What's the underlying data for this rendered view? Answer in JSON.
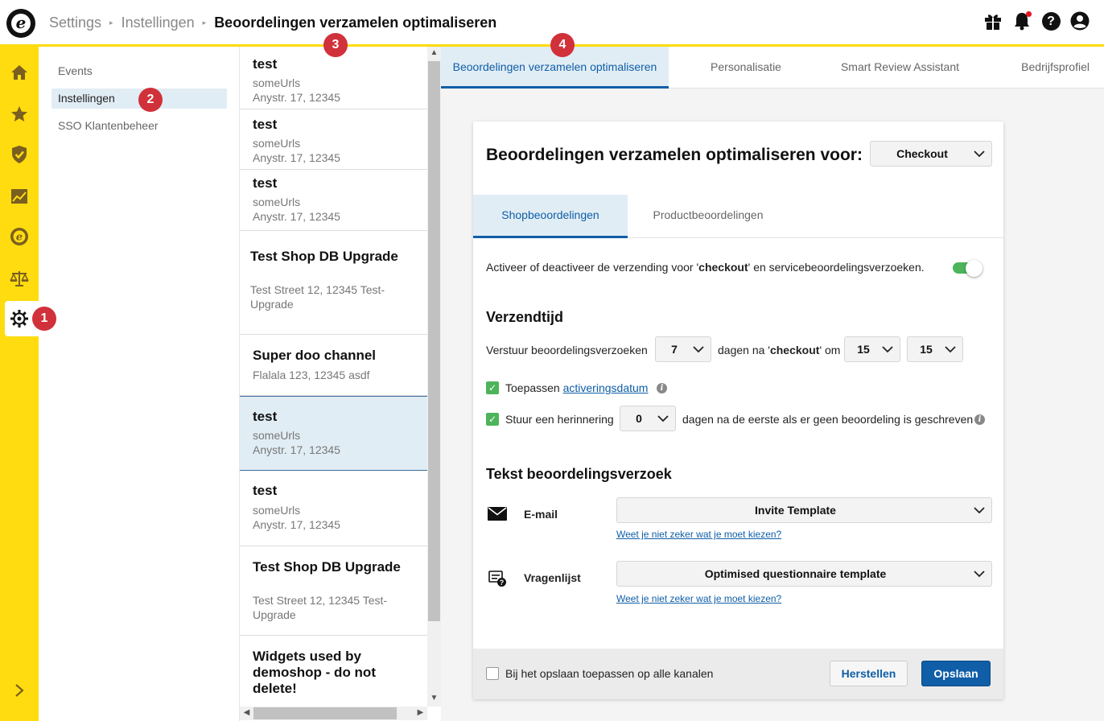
{
  "header": {
    "breadcrumbs": [
      "Settings",
      "Instellingen"
    ],
    "current_page": "Beoordelingen verzamelen optimaliseren",
    "help_glyph": "?",
    "icons": [
      "gift-icon",
      "bell-icon",
      "help-icon",
      "account-icon"
    ],
    "notification_color": "#e3141c"
  },
  "rail": {
    "items": [
      "home-icon",
      "star-icon",
      "shield-check-icon",
      "chart-icon",
      "etrusted-icon",
      "scales-icon",
      "gear-icon"
    ],
    "active": "gear-icon",
    "expand_icon": "chevron-right-icon",
    "accent_color": "#ffdc0f"
  },
  "badges": [
    "1",
    "2",
    "3",
    "4"
  ],
  "subnav": {
    "items": [
      {
        "label": "Events"
      },
      {
        "label": "Instellingen"
      },
      {
        "label": "SSO Klantenbeheer"
      }
    ],
    "active": "Instellingen"
  },
  "channels": [
    {
      "name": "test",
      "lines": [
        "someUrls",
        "Anystr. 17, 12345"
      ]
    },
    {
      "name": "test",
      "lines": [
        "someUrls",
        "Anystr. 17, 12345"
      ]
    },
    {
      "name": "test",
      "lines": [
        "someUrls",
        "Anystr. 17, 12345"
      ]
    },
    {
      "name": "Test Shop DB Upgrade",
      "lines": [
        "Test Street 12, 12345 Test-",
        "Upgrade"
      ]
    },
    {
      "name": "Super doo channel",
      "lines": [
        "Flalala 123, 12345 asdf"
      ]
    },
    {
      "name": "test",
      "lines": [
        "someUrls",
        "Anystr. 17, 12345"
      ]
    },
    {
      "name": "test",
      "lines": [
        "someUrls",
        "Anystr. 17, 12345"
      ]
    },
    {
      "name": "Test Shop DB Upgrade",
      "lines": [
        "Test Street 12, 12345 Test-",
        "Upgrade"
      ]
    },
    {
      "name": "Widgets used by demoshop - do not delete!",
      "name_lines": [
        "Widgets used by",
        "demoshop - do not",
        "delete!"
      ],
      "lines": []
    }
  ],
  "tabs": [
    {
      "label": "Beoordelingen verzamelen optimaliseren",
      "active": true
    },
    {
      "label": "Personalisatie"
    },
    {
      "label": "Smart Review Assistant"
    },
    {
      "label": "Bedrijfsprofiel"
    }
  ],
  "card": {
    "title": "Beoordelingen verzamelen optimaliseren voor:",
    "trigger_select": "Checkout",
    "subtabs": [
      "Shopbeoordelingen",
      "Productbeoordelingen"
    ],
    "toggle_text_before": "Activeer of deactiveer de verzending voor '",
    "toggle_text_bold": "checkout",
    "toggle_text_after": "' en servicebeoordelingsverzoeken.",
    "toggle_on": true,
    "send_time_title": "Verzendtijd",
    "send_prefix": "Verstuur beoordelingsverzoeken",
    "days_value": "7",
    "days_after_prefix": "dagen na '",
    "days_after_bold": "checkout",
    "days_after_suffix": "' om",
    "hour_value": "15",
    "minute_value": "15",
    "apply_label": "Toepassen",
    "apply_link": "activeringsdatum",
    "apply_checked": true,
    "reminder_label": "Stuur een herinnering",
    "reminder_value": "0",
    "reminder_suffix": "dagen na de eerste als er geen beoordeling is geschreven",
    "reminder_checked": true,
    "text_title": "Tekst beoordelingsverzoek",
    "email_label": "E-mail",
    "email_template": "Invite Template",
    "help_link": "Weet je niet zeker wat je moet kiezen?",
    "questionnaire_label": "Vragenlijst",
    "questionnaire_template": "Optimised questionnaire template",
    "apply_all_label": "Bij het opslaan toepassen op alle kanalen",
    "apply_all_checked": false,
    "reset_button": "Herstellen",
    "save_button": "Opslaan"
  }
}
